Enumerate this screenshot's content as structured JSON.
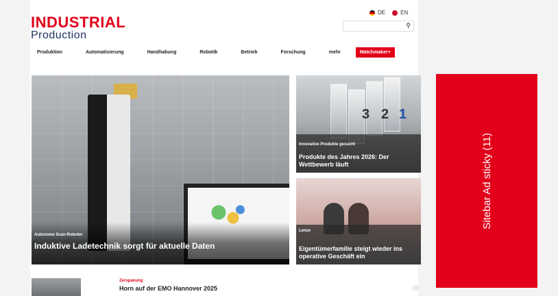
{
  "brand": {
    "line1": "INDUSTRIAL",
    "line2": "Production",
    "primary_color": "#e2001a",
    "secondary_color": "#1d2f5f"
  },
  "lang": {
    "de": "DE",
    "en": "EN"
  },
  "search": {
    "placeholder": ""
  },
  "nav": {
    "items": [
      "Produktion",
      "Automatisierung",
      "Handhabung",
      "Robotik",
      "Betrieb",
      "Forschung",
      "mehr"
    ],
    "cta": "Matchmaker+"
  },
  "hero": {
    "kicker": "Autonome Scan-Roboter",
    "headline": "Induktive Ladetechnik sorgt für aktuelle Daten"
  },
  "card_a": {
    "kicker": "Innovative Produkte gesucht",
    "headline": "Produkte des Jahres 2026: Der Wettbewerb läuft",
    "trophies": [
      "3",
      "2",
      "1"
    ]
  },
  "card_b": {
    "kicker": "Lenze",
    "headline": "Eigentümerfamilie steigt wieder ins operative Geschäft ein"
  },
  "list_item": {
    "kicker": "Zerspanung",
    "title": "Horn auf der EMO Hannover 2025"
  },
  "ad": {
    "label": "Sitebar Ad sticky (11)"
  }
}
